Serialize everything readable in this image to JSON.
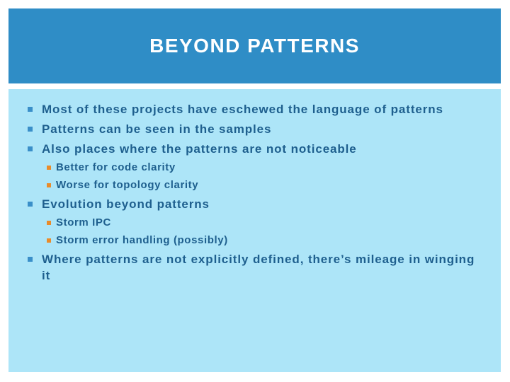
{
  "slide": {
    "title": "BEYOND PATTERNS",
    "colors": {
      "title_bar": "#2f8dc6",
      "content_bg": "#ade5f8",
      "text": "#1e5f8e",
      "bullet_level1": "#3a8fc9",
      "bullet_level2": "#e98b2a"
    },
    "bullets": [
      {
        "level": 1,
        "text": "Most of these projects have eschewed the language of patterns"
      },
      {
        "level": 1,
        "text": "Patterns can be seen in the samples"
      },
      {
        "level": 1,
        "text": "Also places where the patterns are not noticeable"
      },
      {
        "level": 2,
        "text": "Better for code clarity"
      },
      {
        "level": 2,
        "text": "Worse for topology clarity"
      },
      {
        "level": 1,
        "text": "Evolution beyond patterns"
      },
      {
        "level": 2,
        "text": "Storm IPC"
      },
      {
        "level": 2,
        "text": "Storm error handling (possibly)"
      },
      {
        "level": 1,
        "text": "Where patterns are not explicitly defined, there’s mileage in winging it"
      }
    ]
  }
}
